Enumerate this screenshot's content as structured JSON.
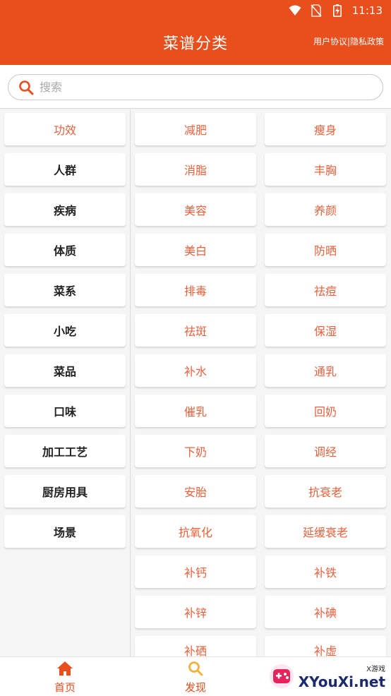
{
  "status_bar": {
    "time": "11:13"
  },
  "header": {
    "title": "菜谱分类",
    "policy_link": "用户协议|隐私政策"
  },
  "search": {
    "placeholder": "搜索"
  },
  "categories": [
    {
      "label": "功效"
    },
    {
      "label": "人群"
    },
    {
      "label": "疾病"
    },
    {
      "label": "体质"
    },
    {
      "label": "菜系"
    },
    {
      "label": "小吃"
    },
    {
      "label": "菜品"
    },
    {
      "label": "口味"
    },
    {
      "label": "加工工艺"
    },
    {
      "label": "厨房用具"
    },
    {
      "label": "场景"
    }
  ],
  "tags": [
    "减肥",
    "瘦身",
    "消脂",
    "丰胸",
    "美容",
    "养颜",
    "美白",
    "防晒",
    "排毒",
    "祛痘",
    "祛斑",
    "保湿",
    "补水",
    "通乳",
    "催乳",
    "回奶",
    "下奶",
    "调经",
    "安胎",
    "抗衰老",
    "抗氧化",
    "延缓衰老",
    "补钙",
    "补铁",
    "补锌",
    "补碘",
    "补硒",
    "补虚"
  ],
  "bottom_nav": [
    {
      "label": "首页",
      "icon": "home-icon"
    },
    {
      "label": "发现",
      "icon": "search-icon"
    }
  ],
  "watermark": {
    "small": "X游戏",
    "big": "XYouXi.net"
  },
  "colors": {
    "accent": "#e84f1d",
    "tag_text": "#e8603c"
  }
}
